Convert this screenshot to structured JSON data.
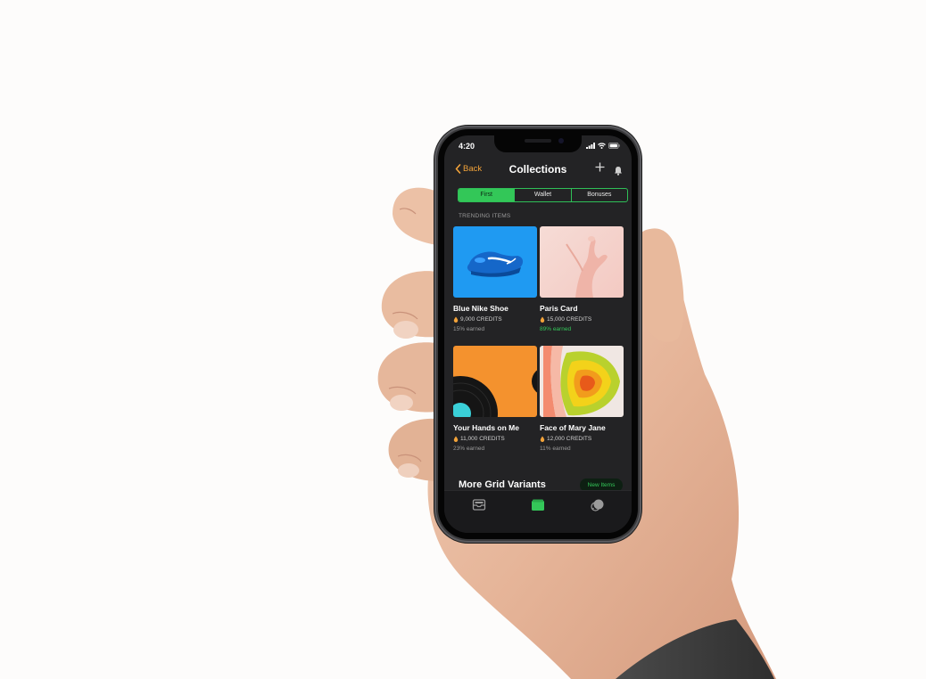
{
  "status_bar": {
    "time": "4:20"
  },
  "nav": {
    "back_label": "Back",
    "title": "Collections"
  },
  "segments": [
    {
      "label": "First",
      "active": true
    },
    {
      "label": "Wallet",
      "active": false
    },
    {
      "label": "Bonuses",
      "active": false
    }
  ],
  "trending": {
    "label": "TRENDING ITEMS",
    "items": [
      {
        "name": "Blue Nike Shoe",
        "credits": "9,000 CREDITS",
        "earned": "15% earned"
      },
      {
        "name": "Paris Card",
        "credits": "15,000 CREDITS",
        "earned": "89% earned"
      },
      {
        "name": "Your Hands on Me",
        "credits": "11,000 CREDITS",
        "earned": "23% earned"
      },
      {
        "name": "Face of Mary Jane",
        "credits": "12,000 CREDITS",
        "earned": "11% earned"
      }
    ]
  },
  "more": {
    "title": "More Grid Variants",
    "button_label": "New Items"
  },
  "tabbar": {
    "tabs": [
      {
        "icon": "inbox-icon",
        "active": false
      },
      {
        "icon": "wallet-icon",
        "active": true
      },
      {
        "icon": "chat-icon",
        "active": false
      }
    ]
  },
  "colors": {
    "accent_green": "#34c759",
    "accent_orange": "#f2a33a",
    "screen_bg": "#232325"
  }
}
